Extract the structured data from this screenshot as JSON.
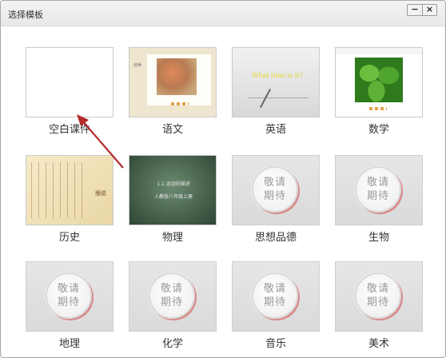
{
  "window": {
    "title": "选择模板",
    "minimize_symbol": "−",
    "close_symbol": "×"
  },
  "badge": {
    "line1": "敬请",
    "line2": "期待"
  },
  "templates": [
    {
      "label": "空白课件"
    },
    {
      "label": "语文",
      "thumb_tag": "创世"
    },
    {
      "label": "英语",
      "thumb_text": "What time is it?"
    },
    {
      "label": "数学"
    },
    {
      "label": "历史",
      "thumb_sig": "细说"
    },
    {
      "label": "物理",
      "thumb_line1": "1.1 运动的描述",
      "thumb_line2": "人教版八年级上册"
    },
    {
      "label": "思想品德"
    },
    {
      "label": "生物"
    },
    {
      "label": "地理"
    },
    {
      "label": "化学"
    },
    {
      "label": "音乐"
    },
    {
      "label": "美术"
    }
  ],
  "colors": {
    "arrow": "#b22a2a",
    "accent_dots": "#e0a24c"
  }
}
